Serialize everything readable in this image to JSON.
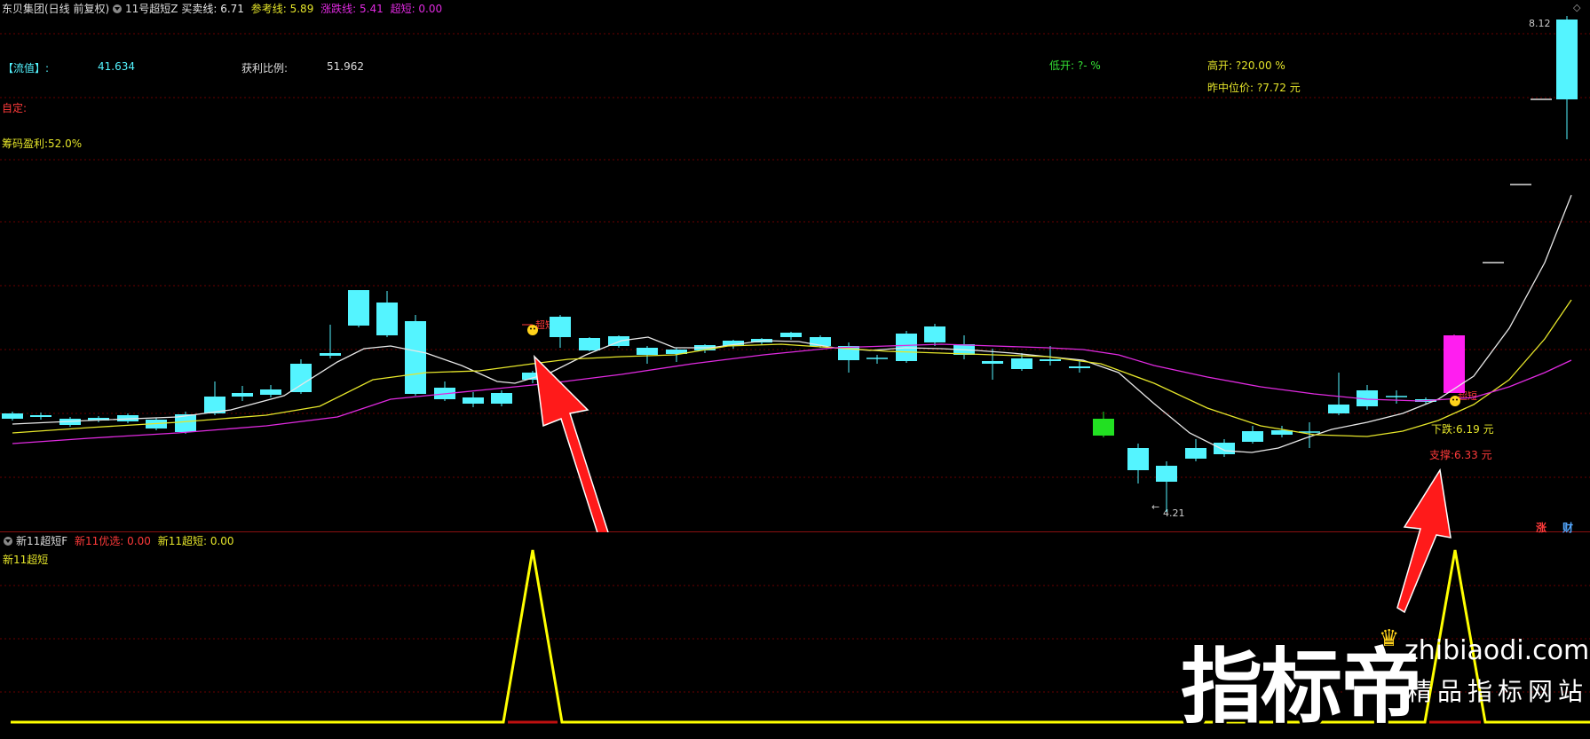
{
  "header": {
    "stock": "东贝集团(日线 前复权)",
    "indicator": "11号超短Z",
    "buy_sell_label": "买卖线: 6.71",
    "ref_label": "参考线: 5.89",
    "rise_fall_label": "涨跌线: 5.41",
    "ultra_label": "超短: 0.00"
  },
  "info": {
    "float_cap_label": "【流值】:",
    "float_cap_value": "41.634",
    "profit_ratio_label": "获利比例:",
    "profit_ratio_value": "51.962",
    "low_open": "低开: ?- %",
    "high_open": "高开: ?20.00 %",
    "mid_price": "昨中位价: ?7.72 元",
    "custom": "自定:",
    "chip_profit": "筹码盈利:52.0%",
    "price_top": "8.12",
    "price_low": "4.21",
    "down_label": "下跌:6.19 元",
    "support_label": "支撑:6.33 元",
    "signal_left": "超短",
    "signal_right": "超短",
    "badge_rise": "涨",
    "badge_fin": "财"
  },
  "sub_header": {
    "indicator": "新11超短F",
    "optimal_label": "新11优选: 0.00",
    "ultra_label": "新11超短: 0.00",
    "series_name": "新11超短"
  },
  "watermark": {
    "brand": "指标帝",
    "url": "zhibiaodi.com",
    "slogan": "精品指标网站"
  },
  "colors": {
    "up": "#ff3a3a",
    "down": "#54f4ff",
    "ma_short": "#e8e8e8",
    "ma_mid": "#e5e52a",
    "ma_long": "#e02ae0",
    "signal": "#ffff00",
    "arrow": "#ff1a1a"
  }
}
